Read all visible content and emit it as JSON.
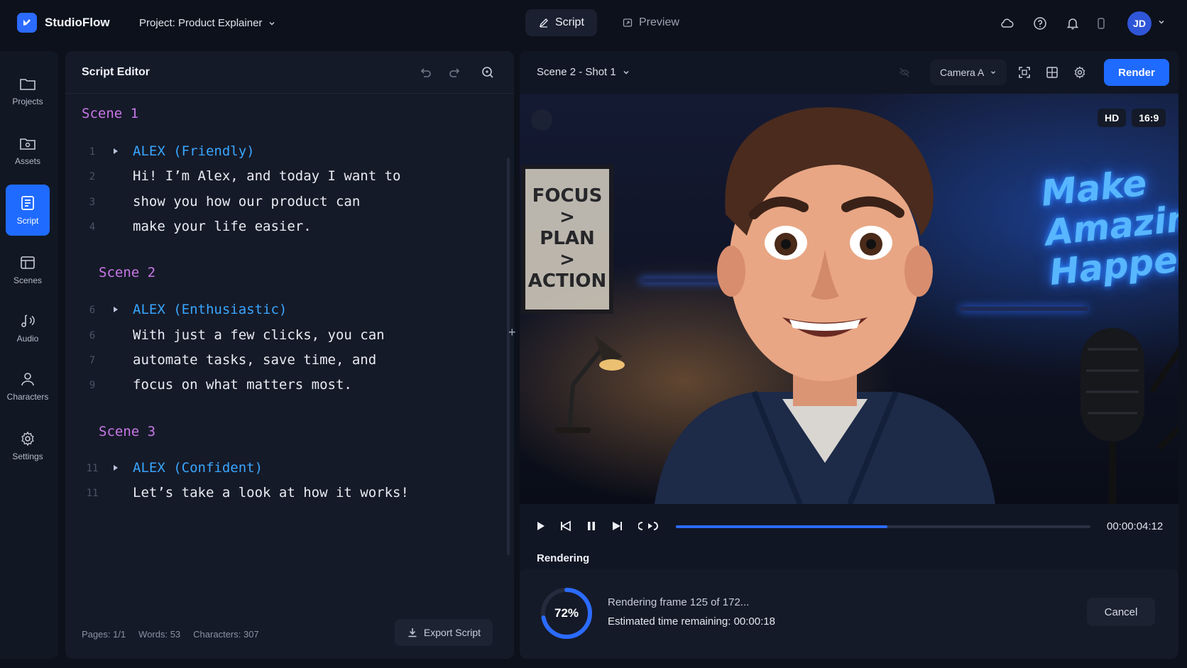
{
  "app": {
    "name": "StudioFlow",
    "project_label": "Project: Product Explainer",
    "user_initials": "JD"
  },
  "tabs": [
    {
      "label": "Script",
      "active": true
    },
    {
      "label": "Preview",
      "active": false
    }
  ],
  "sidebar": {
    "items": [
      {
        "label": "Projects",
        "icon": "folder-icon"
      },
      {
        "label": "Assets",
        "icon": "assets-folder-icon"
      },
      {
        "label": "Script",
        "icon": "script-doc-icon",
        "active": true
      },
      {
        "label": "Scenes",
        "icon": "scenes-icon"
      },
      {
        "label": "Audio",
        "icon": "audio-icon"
      },
      {
        "label": "Characters",
        "icon": "user-icon"
      },
      {
        "label": "Settings",
        "icon": "gear-icon"
      }
    ]
  },
  "editor": {
    "title": "Script Editor",
    "scenes": [
      {
        "heading": "Scene 1",
        "lines": [
          {
            "num": "1",
            "type": "character",
            "text": "ALEX (Friendly)"
          },
          {
            "num": "2",
            "type": "dialogue",
            "text": "Hi! I’m Alex, and today I want to"
          },
          {
            "num": "3",
            "type": "dialogue",
            "text": "show you how our product can"
          },
          {
            "num": "4",
            "type": "dialogue",
            "text": "make your life easier."
          }
        ]
      },
      {
        "heading": "Scene 2",
        "lines": [
          {
            "num": "6",
            "type": "character",
            "text": "ALEX (Enthusiastic)"
          },
          {
            "num": "6",
            "type": "dialogue",
            "text": "With just a few clicks, you can"
          },
          {
            "num": "7",
            "type": "dialogue",
            "text": "automate tasks, save time, and"
          },
          {
            "num": "9",
            "type": "dialogue",
            "text": "focus on what matters most."
          }
        ]
      },
      {
        "heading": "Scene 3",
        "lines": [
          {
            "num": "11",
            "type": "character",
            "text": "ALEX (Confident)"
          },
          {
            "num": "11",
            "type": "dialogue",
            "text": "Let’s take a look at how it works!"
          }
        ]
      }
    ],
    "stats": {
      "pages": "Pages: 1/1",
      "words": "Words: 53",
      "characters": "Characters: 307"
    },
    "export_label": "Export Script"
  },
  "preview": {
    "shot_label": "Scene 2 - Shot 1",
    "camera_label": "Camera A",
    "render_label": "Render",
    "badges": {
      "quality": "HD",
      "aspect": "16:9"
    },
    "poster_text": [
      "FOCUS",
      ">",
      "PLAN",
      ">",
      "ACTION"
    ],
    "neon_text": [
      "Make",
      "Amazing",
      "Happen"
    ],
    "timecode": "00:00:04:12",
    "progress": 0.51
  },
  "rendering": {
    "label": "Rendering",
    "percent_text": "72%",
    "percent": 72,
    "frame_text": "Rendering frame 125 of 172...",
    "eta_text": "Estimated time remaining: 00:00:18",
    "cancel_label": "Cancel"
  },
  "colors": {
    "accent": "#1f6bff",
    "scene_heading": "#c878e8",
    "character": "#39a6ff"
  }
}
